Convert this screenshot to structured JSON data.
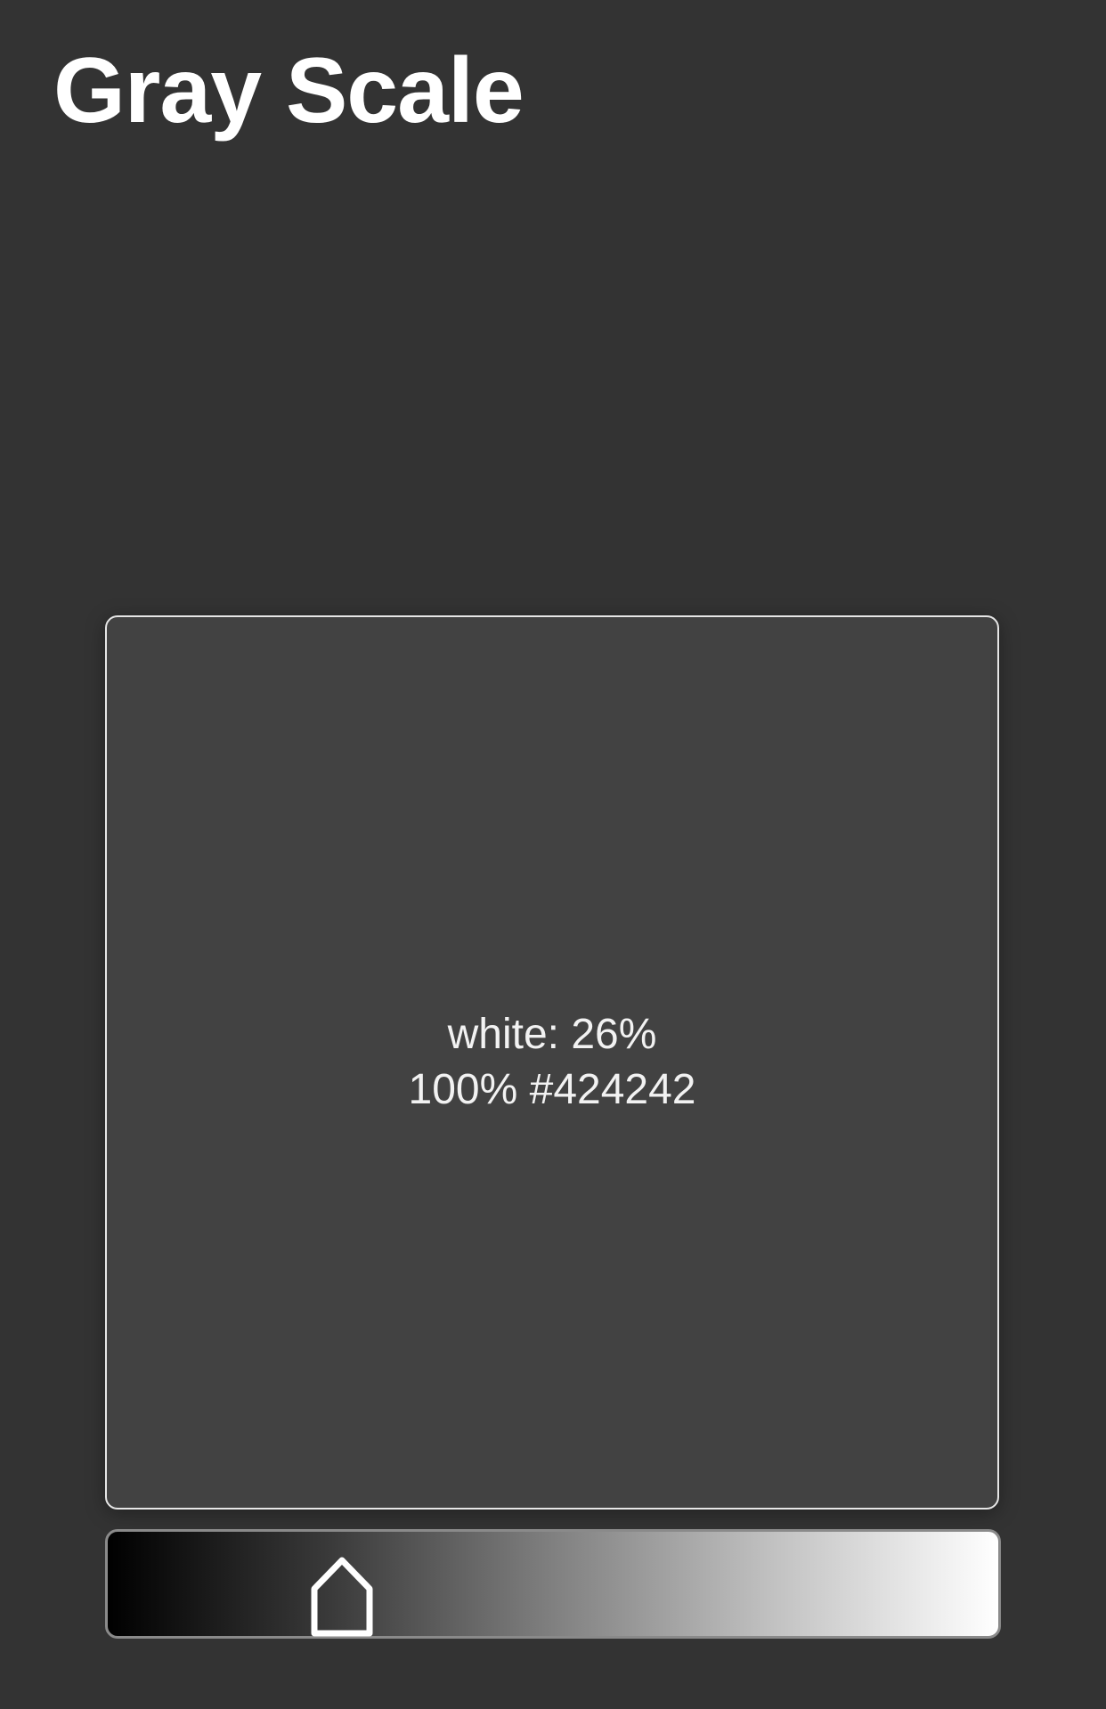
{
  "header": {
    "title": "Gray Scale"
  },
  "swatch": {
    "line1": "white: 26%",
    "line2": "100% #424242",
    "color": "#424242"
  },
  "slider": {
    "value_fraction": 0.26,
    "thumb_icon": "house-outline-icon",
    "gradient_start": "#000000",
    "gradient_end": "#ffffff"
  }
}
